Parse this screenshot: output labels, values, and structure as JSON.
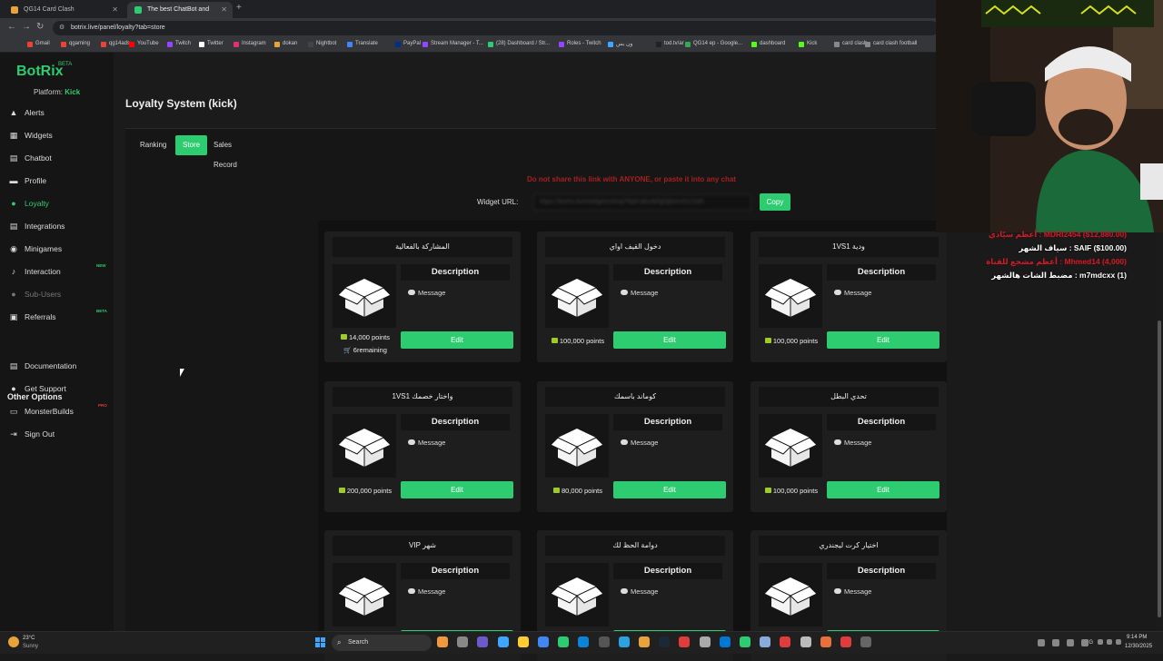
{
  "browser": {
    "tabs": [
      {
        "label": "QG14 Card Clash"
      },
      {
        "label": "The best ChatBot and Widgets"
      }
    ],
    "url": "botrix.live/panel/loyalty?tab=store",
    "bookmarks": [
      {
        "label": "Gmail",
        "color": "#ea4335"
      },
      {
        "label": "qgaming",
        "color": "#ea4335"
      },
      {
        "label": "qg14ads",
        "color": "#ea4335"
      },
      {
        "label": "YouTube",
        "color": "#ff0000"
      },
      {
        "label": "Twitch",
        "color": "#9146ff"
      },
      {
        "label": "Twitter",
        "color": "#ffffff"
      },
      {
        "label": "Instagram",
        "color": "#e1306c"
      },
      {
        "label": "dokan",
        "color": "#e8a33b"
      },
      {
        "label": "Nightbot",
        "color": "#444444"
      },
      {
        "label": "Translate",
        "color": "#4285f4"
      },
      {
        "label": "PayPal",
        "color": "#003087"
      },
      {
        "label": "Stream Manager - T...",
        "color": "#9146ff"
      },
      {
        "label": "(28) Dashboard / Str...",
        "color": "#2ecc71"
      },
      {
        "label": "Roles - Twitch",
        "color": "#9146ff"
      },
      {
        "label": "ون بس",
        "color": "#3ea6ff"
      },
      {
        "label": "tod.tv/ar",
        "color": "#222222"
      },
      {
        "label": "QG14 ep - Google...",
        "color": "#34a853"
      },
      {
        "label": "dashboard",
        "color": "#53fc18"
      },
      {
        "label": "Kick",
        "color": "#53fc18"
      },
      {
        "label": "card clash",
        "color": "#888888"
      },
      {
        "label": "card clash football",
        "color": "#888888"
      }
    ]
  },
  "sidebar": {
    "logo": "BotRix",
    "logo_badge": "BETA",
    "platform_label": "Platform:",
    "platform_value": "Kick",
    "items": [
      {
        "label": "Alerts",
        "icon": "alert-icon"
      },
      {
        "label": "Widgets",
        "icon": "widgets-icon"
      },
      {
        "label": "Chatbot",
        "icon": "chatbot-icon"
      },
      {
        "label": "Profile",
        "icon": "profile-icon"
      },
      {
        "label": "Loyalty",
        "icon": "loyalty-icon",
        "active": true
      },
      {
        "label": "Integrations",
        "icon": "integrations-icon"
      },
      {
        "label": "Minigames",
        "icon": "gamepad-icon"
      },
      {
        "label": "Interaction",
        "icon": "music-icon",
        "badge": "NEW"
      },
      {
        "label": "Sub-Users",
        "icon": "users-icon",
        "dim": true
      },
      {
        "label": "Referrals",
        "icon": "referrals-icon",
        "badge": "BETA"
      }
    ],
    "other_options_title": "Other Options",
    "other_items": [
      {
        "label": "Documentation",
        "icon": "document-icon"
      },
      {
        "label": "Get Support",
        "icon": "support-icon"
      },
      {
        "label": "MonsterBuilds",
        "icon": "monitor-icon",
        "badge": "PRO"
      },
      {
        "label": "Sign Out",
        "icon": "sign-out-icon"
      }
    ]
  },
  "page": {
    "title": "Loyalty System (kick)",
    "tabs": [
      "Ranking",
      "Store",
      "Sales Record"
    ],
    "active_tab": "Store",
    "warning": "Do not share this link with ANYONE, or paste it into any chat",
    "widget_url_label": "Widget URL:",
    "widget_url_value": "https://botrix.live/widgets/shop?bid=abcdefghijklmn012345",
    "copy_label": "Copy"
  },
  "store_items": [
    {
      "title": "المشاركة بالفعالية",
      "description": "Description",
      "message": "Message",
      "price": "14,000 points",
      "remaining": "6remaining",
      "edit": "Edit"
    },
    {
      "title": "دخول القيف اواي",
      "description": "Description",
      "message": "Message",
      "price": "100,000 points",
      "edit": "Edit"
    },
    {
      "title": "ودية 1VS1",
      "description": "Description",
      "message": "Message",
      "price": "100,000 points",
      "edit": "Edit"
    },
    {
      "title": "واختار خصمك 1VS1",
      "description": "Description",
      "message": "Message",
      "price": "200,000 points",
      "edit": "Edit"
    },
    {
      "title": "كوماند باسمك",
      "description": "Description",
      "message": "Message",
      "price": "80,000 points",
      "edit": "Edit"
    },
    {
      "title": "تحدي البطل",
      "description": "Description",
      "message": "Message",
      "price": "100,000 points",
      "edit": "Edit"
    },
    {
      "title": "شهر VIP",
      "description": "Description",
      "message": "Message",
      "edit": "Edit"
    },
    {
      "title": "دوامة الحظ لك",
      "description": "Description",
      "message": "Message",
      "edit": "Edit"
    },
    {
      "title": "اختيار كرت ليجندري",
      "description": "Description",
      "message": "Message",
      "edit": "Edit"
    }
  ],
  "stream_overlay": {
    "lines": [
      {
        "text": "أعظم سيّادي : MDRI2454 ($12,880.00)",
        "color": "red"
      },
      {
        "text": "سياف الشهر : SAIF ($100.00)",
        "color": "white"
      },
      {
        "text": "أعظم مشجع للقناة : Mhmed14 (4,000)",
        "color": "red"
      },
      {
        "text": "مضبط الشات هالشهر : m7mdcxx (1)",
        "color": "white"
      }
    ]
  },
  "taskbar": {
    "weather_temp": "23°C",
    "weather_cond": "Sunny",
    "search_placeholder": "Search",
    "language": "ENG",
    "time": "9:14 PM",
    "date": "12/30/2025"
  }
}
